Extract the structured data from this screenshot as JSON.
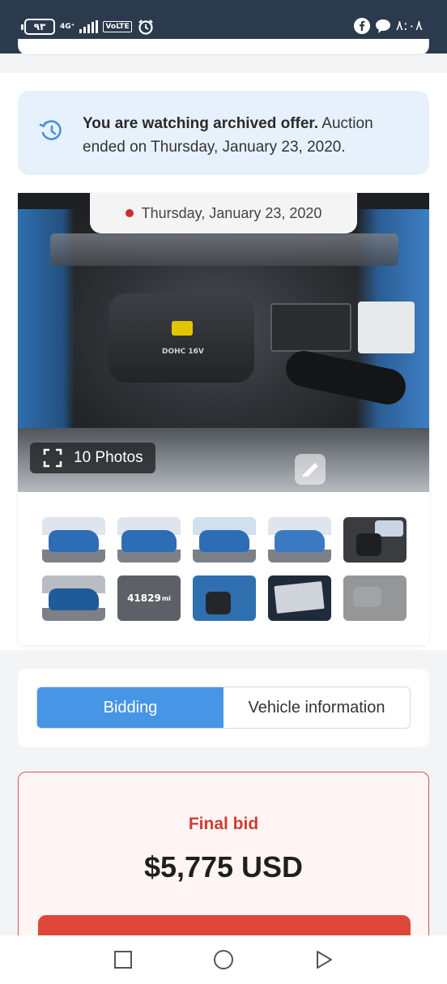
{
  "status_bar": {
    "battery": "٩٣",
    "network": "4G⁺",
    "volte": "VoLTE",
    "time": "٨:٠٨",
    "icons": [
      "alarm-icon",
      "facebook-icon",
      "chat-icon"
    ]
  },
  "notice": {
    "bold": "You are watching archived offer.",
    "text": " Auction ended on Thursday, January 23, 2020.",
    "icon": "history-icon",
    "accent": "#4a90d9"
  },
  "gallery": {
    "date": "Thursday, January 23, 2020",
    "photos_label": "10 Photos",
    "thumbnails": [
      {
        "kind": "car"
      },
      {
        "kind": "car"
      },
      {
        "kind": "car"
      },
      {
        "kind": "car"
      },
      {
        "kind": "interior"
      },
      {
        "kind": "car"
      },
      {
        "kind": "odometer",
        "value": "41829",
        "unit": "mi"
      },
      {
        "kind": "interior"
      },
      {
        "kind": "label"
      },
      {
        "kind": "engine"
      }
    ]
  },
  "tabs": {
    "bidding": "Bidding",
    "vehicle_info": "Vehicle information",
    "active": "Bidding"
  },
  "bid": {
    "label": "Final bid",
    "value": "$5,775 USD",
    "accent": "#d23b2f"
  },
  "nav": {
    "icons": [
      "square-recents-icon",
      "circle-home-icon",
      "triangle-back-icon"
    ]
  }
}
